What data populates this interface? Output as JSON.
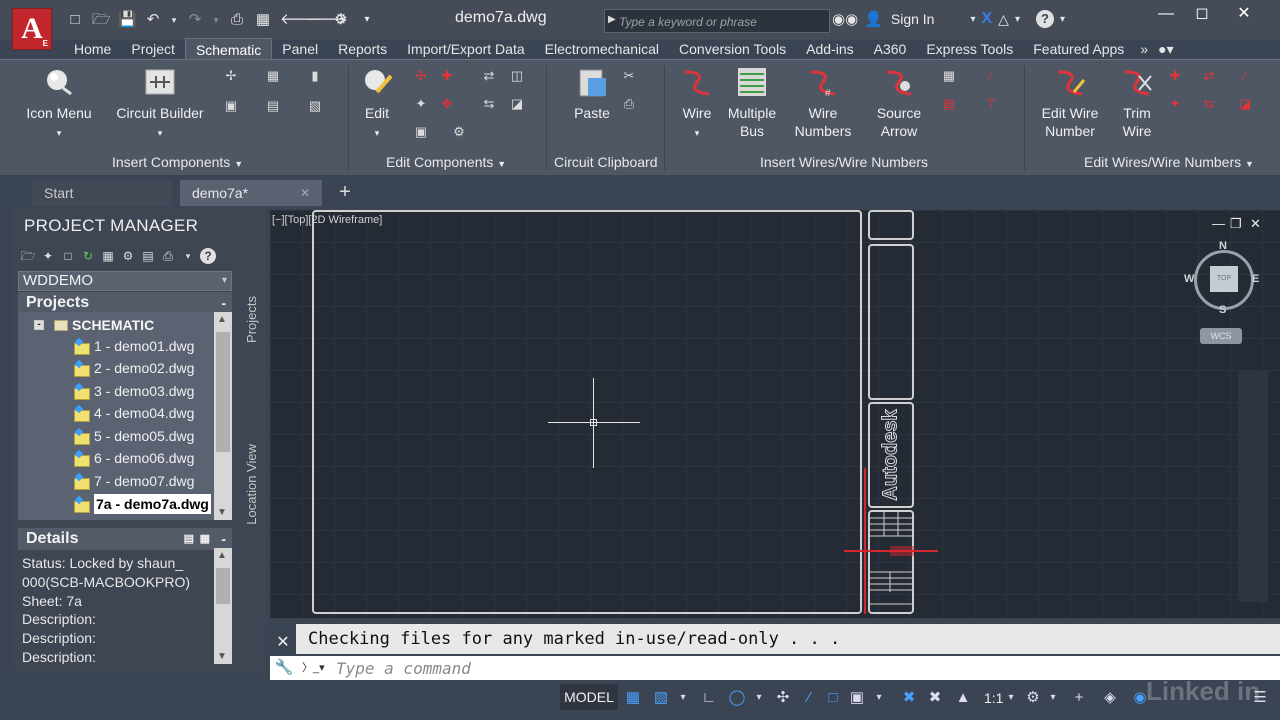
{
  "window": {
    "doc_title": "demo7a.dwg",
    "search_placeholder": "Type a keyword or phrase",
    "signin_label": "Sign In",
    "app_logo": "A"
  },
  "ribbon_tabs": [
    "Home",
    "Project",
    "Schematic",
    "Panel",
    "Reports",
    "Import/Export Data",
    "Electromechanical",
    "Conversion Tools",
    "Add-ins",
    "A360",
    "Express Tools",
    "Featured Apps"
  ],
  "active_tab": "Schematic",
  "ribbon": {
    "icon_menu": "Icon Menu",
    "circuit_builder": "Circuit Builder",
    "edit": "Edit",
    "paste": "Paste",
    "wire": "Wire",
    "multiple_bus_1": "Multiple",
    "multiple_bus_2": "Bus",
    "wire_numbers_1": "Wire",
    "wire_numbers_2": "Numbers",
    "source_arrow_1": "Source",
    "source_arrow_2": "Arrow",
    "edit_wire_number_1": "Edit Wire",
    "edit_wire_number_2": "Number",
    "trim_wire_1": "Trim",
    "trim_wire_2": "Wire",
    "groups": {
      "insert_components": "Insert Components",
      "edit_components": "Edit Components",
      "circuit_clipboard": "Circuit Clipboard",
      "insert_wires": "Insert Wires/Wire Numbers",
      "edit_wires": "Edit Wires/Wire Numbers"
    }
  },
  "doc_tabs": {
    "start": "Start",
    "current": "demo7a*"
  },
  "project_manager": {
    "title": "PROJECT MANAGER",
    "project": "WDDEMO",
    "projects_header": "Projects",
    "folder": "SCHEMATIC",
    "drawings": [
      "1 - demo01.dwg",
      "2 - demo02.dwg",
      "3 - demo03.dwg",
      "4 - demo04.dwg",
      "5 - demo05.dwg",
      "6 - demo06.dwg",
      "7 - demo07.dwg",
      "7a - demo7a.dwg"
    ],
    "selected_drawing": "7a - demo7a.dwg",
    "details_header": "Details",
    "details": [
      "Status: Locked by shaun_",
      "000(SCB-MACBOOKPRO)",
      "Sheet: 7a",
      "Description:",
      "Description:",
      "Description:"
    ],
    "side_tab_projects": "Projects",
    "side_tab_location": "Location View"
  },
  "viewport": {
    "label": "[−][Top][2D Wireframe]",
    "titleblock_logo": "Autodesk",
    "viewcube_face": "TOP",
    "compass": {
      "n": "N",
      "s": "S",
      "e": "E",
      "w": "W"
    },
    "wcs": "WCS"
  },
  "command": {
    "history": "Checking files for any marked in-use/read-only . . .",
    "placeholder": "Type a command"
  },
  "statusbar": {
    "model": "MODEL",
    "scale": "1:1"
  },
  "watermark": "Linked in",
  "colors": {
    "accent_red": "#c1272d",
    "background": "#252b35",
    "wire_red": "#e0333a"
  }
}
